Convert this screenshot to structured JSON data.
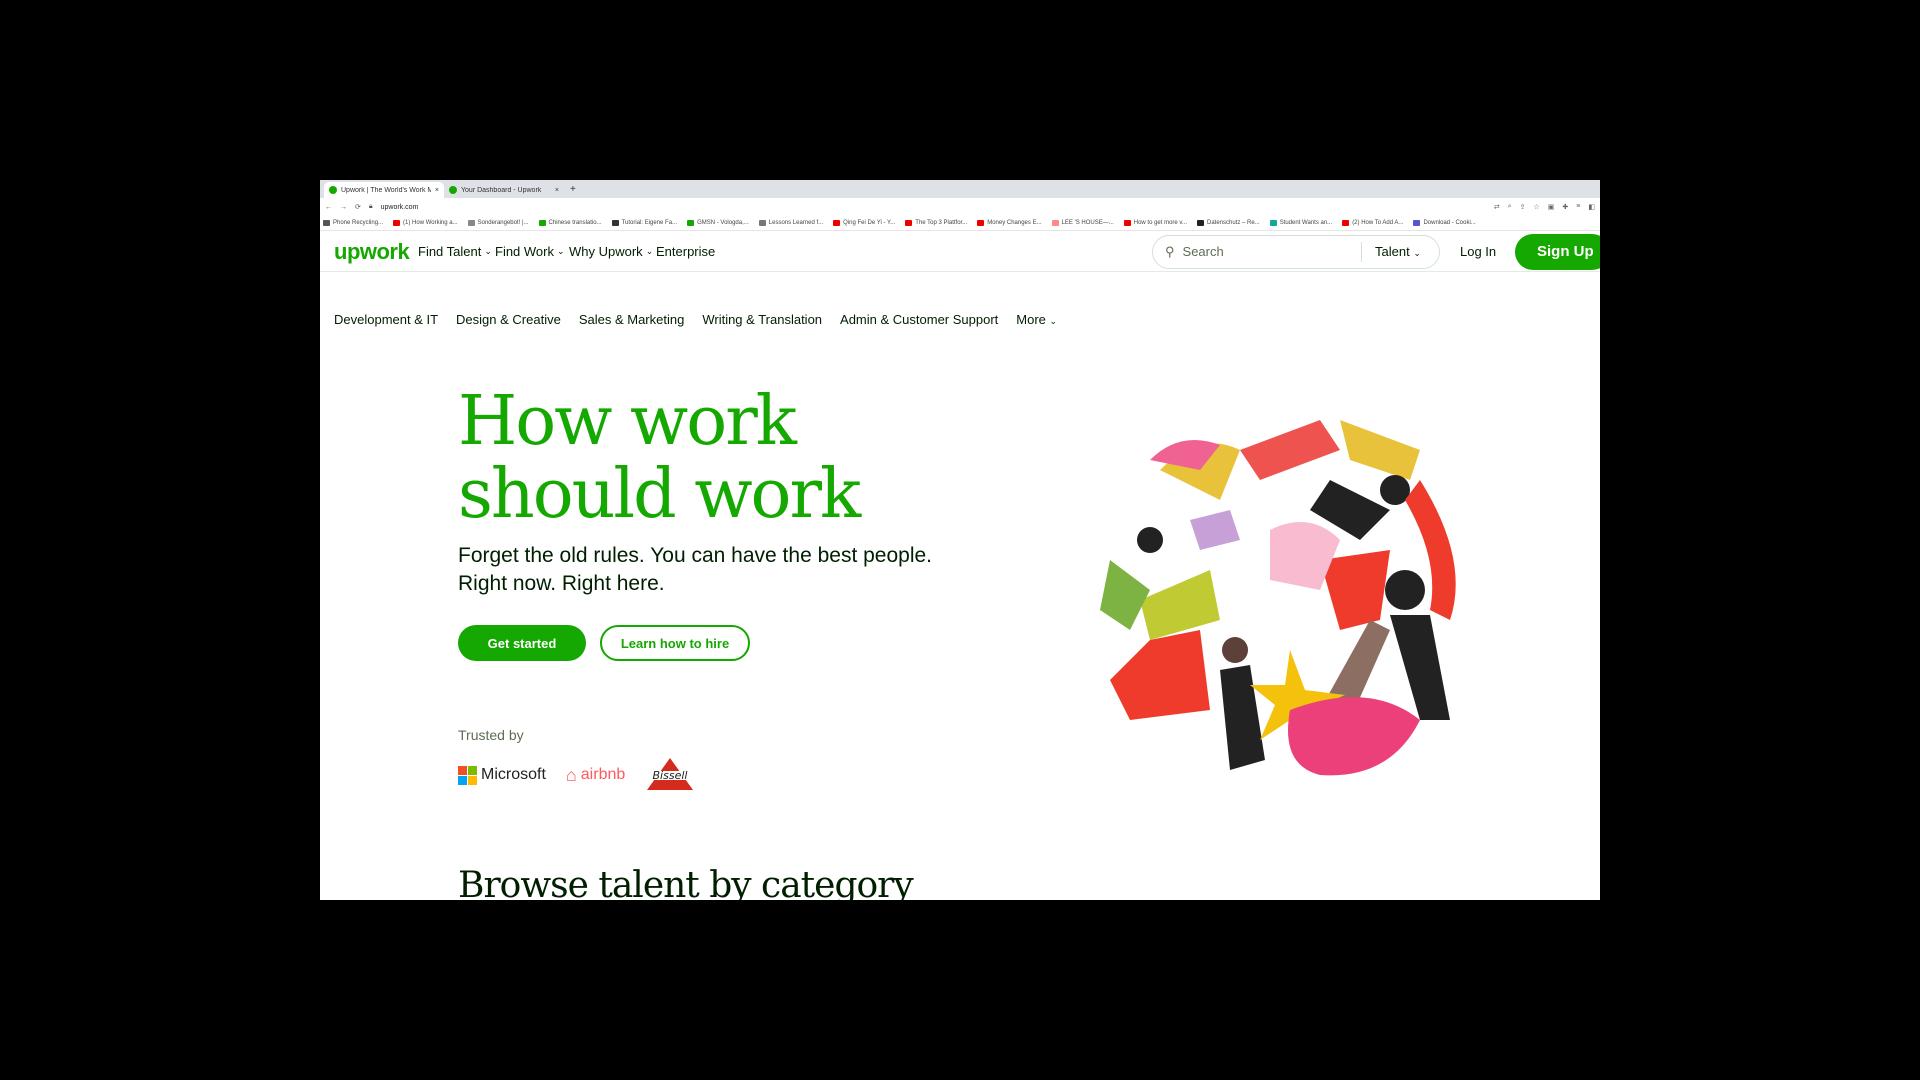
{
  "browser": {
    "tabs": [
      {
        "title": "Upwork | The World's Work M..."
      },
      {
        "title": "Your Dashboard - Upwork"
      }
    ],
    "new_tab": "+",
    "url": "upwork.com",
    "bookmarks": [
      {
        "label": "Phone Recycling...",
        "color": "#555"
      },
      {
        "label": "(1) How Working a...",
        "color": "#e00"
      },
      {
        "label": "Sonderangebot! |...",
        "color": "#888"
      },
      {
        "label": "Chinese translatio...",
        "color": "#14a800"
      },
      {
        "label": "Tutorial: Eigene Fa...",
        "color": "#333"
      },
      {
        "label": "GMSN - Vologda,...",
        "color": "#14a800"
      },
      {
        "label": "Lessons Learned f...",
        "color": "#777"
      },
      {
        "label": "Qing Fei De Yi - Y...",
        "color": "#e00"
      },
      {
        "label": "The Top 3 Plattfor...",
        "color": "#e00"
      },
      {
        "label": "Money Changes E...",
        "color": "#e00"
      },
      {
        "label": "LEE 'S HOUSE—...",
        "color": "#f88"
      },
      {
        "label": "How to get more v...",
        "color": "#e00"
      },
      {
        "label": "Datenschutz – Re...",
        "color": "#222"
      },
      {
        "label": "Student Wants an...",
        "color": "#1a9"
      },
      {
        "label": "(2) How To Add A...",
        "color": "#e00"
      },
      {
        "label": "Download - Cooki...",
        "color": "#55c"
      }
    ]
  },
  "nav": {
    "logo": "upwork",
    "items": [
      "Find Talent",
      "Find Work",
      "Why Upwork",
      "Enterprise"
    ],
    "search_placeholder": "Search",
    "search_scope": "Talent",
    "login": "Log In",
    "signup": "Sign Up"
  },
  "categories": [
    "Development & IT",
    "Design & Creative",
    "Sales & Marketing",
    "Writing & Translation",
    "Admin & Customer Support",
    "More"
  ],
  "hero": {
    "title_line1": "How work",
    "title_line2": "should work",
    "subtitle_line1": "Forget the old rules. You can have the best people.",
    "subtitle_line2": "Right now. Right here.",
    "cta_primary": "Get started",
    "cta_secondary": "Learn how to hire",
    "trusted_by": "Trusted by",
    "logos": [
      "Microsoft",
      "airbnb",
      "Bissell"
    ]
  },
  "browse_heading": "Browse talent by category",
  "colors": {
    "brand": "#14a800",
    "text": "#001e00"
  }
}
